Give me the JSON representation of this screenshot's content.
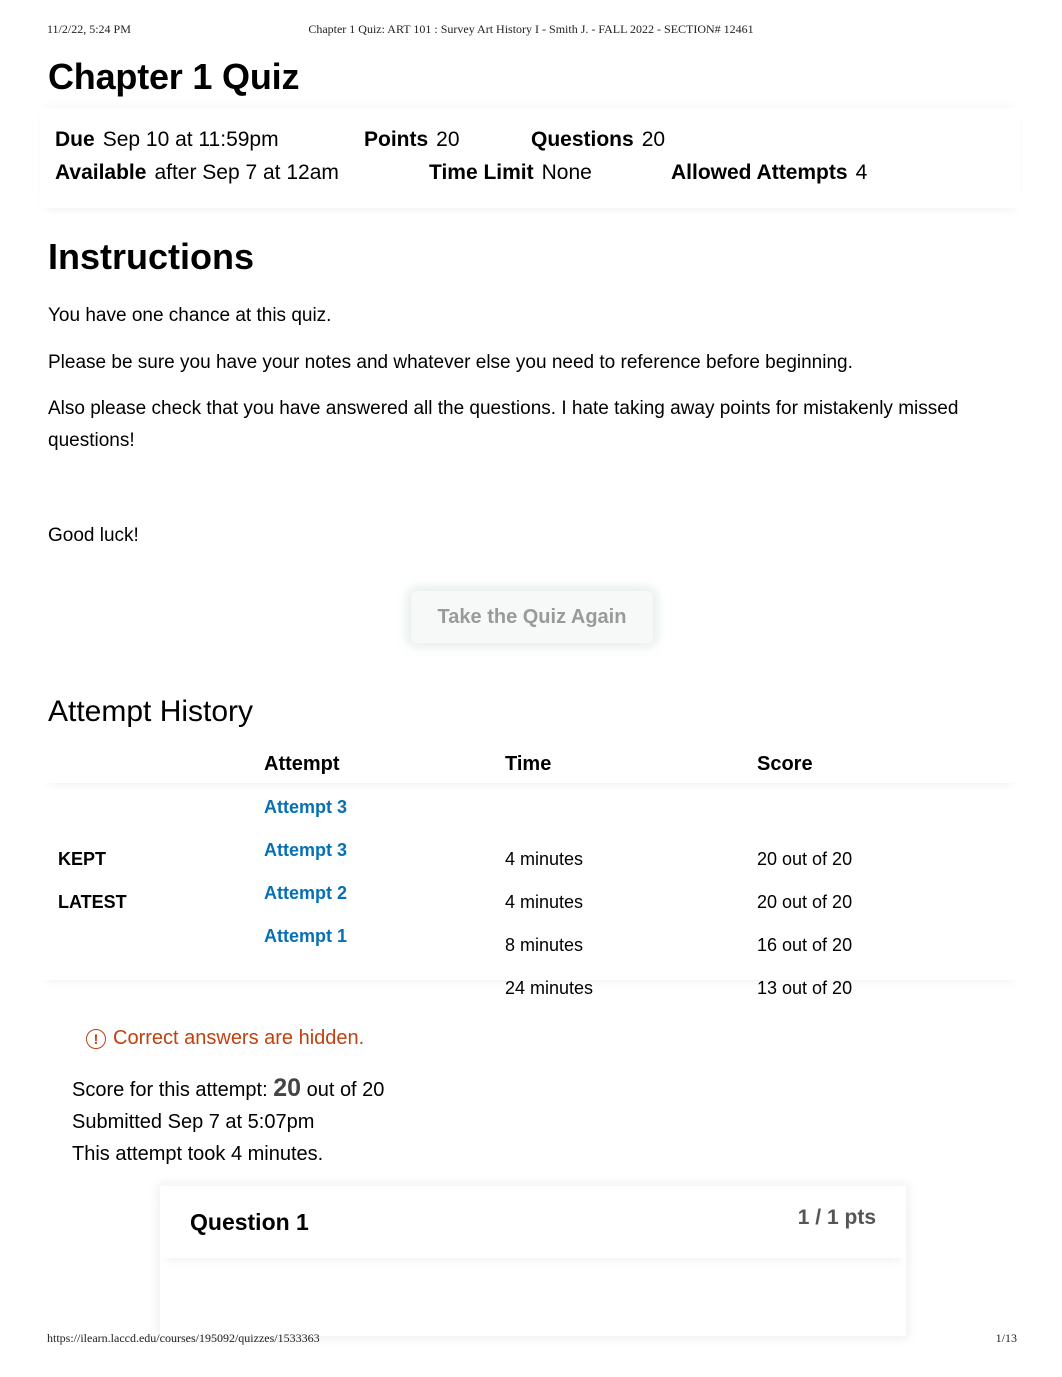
{
  "print_header": {
    "date": "11/2/22, 5:24 PM",
    "title": "Chapter 1 Quiz: ART 101 : Survey Art History I - Smith J. - FALL 2022 - SECTION# 12461"
  },
  "print_footer": {
    "url": "https://ilearn.laccd.edu/courses/195092/quizzes/1533363",
    "page": "1/13"
  },
  "quiz": {
    "title": "Chapter 1 Quiz",
    "meta": {
      "due_label": "Due",
      "due_value": "Sep 10 at 11:59pm",
      "points_label": "Points",
      "points_value": "20",
      "questions_label": "Questions",
      "questions_value": "20",
      "available_label": "Available",
      "available_value": "after Sep 7 at 12am",
      "time_limit_label": "Time Limit",
      "time_limit_value": "None",
      "allowed_attempts_label": "Allowed Attempts",
      "allowed_attempts_value": "4"
    }
  },
  "instructions": {
    "heading": "Instructions",
    "paragraphs": [
      "You have one chance at this quiz.",
      "Please be sure you have your notes and whatever else you need to reference before beginning.",
      "Also please check that you have answered all the questions. I hate taking away points for mistakenly missed questions!",
      "Good luck!"
    ]
  },
  "take_again_button": "Take the Quiz Again",
  "attempt_history": {
    "heading": "Attempt History",
    "columns": [
      "",
      "Attempt",
      "Time",
      "Score"
    ],
    "rows": [
      {
        "label": "KEPT",
        "attempt": "Attempt 3",
        "time": "4 minutes",
        "score": "20 out of 20"
      },
      {
        "label": "LATEST",
        "attempt": "Attempt 3",
        "time": "4 minutes",
        "score": "20 out of 20"
      },
      {
        "label": "",
        "attempt": "Attempt 2",
        "time": "8 minutes",
        "score": "16 out of 20"
      },
      {
        "label": "",
        "attempt": "Attempt 1",
        "time": "24 minutes",
        "score": "13 out of 20"
      }
    ]
  },
  "notice": {
    "icon": "warning-circle-icon",
    "text": "Correct answers are hidden.",
    "color": "#c1400e"
  },
  "attempt_summary": {
    "score_prefix": "Score for this attempt:",
    "score_value": "20",
    "score_suffix": "out of 20",
    "submitted": "Submitted Sep 7 at 5:07pm",
    "duration": "This attempt took 4 minutes."
  },
  "question": {
    "title": "Question 1",
    "points": "1 / 1 pts"
  },
  "colors": {
    "link": "#0770b5",
    "warning": "#c1400e"
  }
}
